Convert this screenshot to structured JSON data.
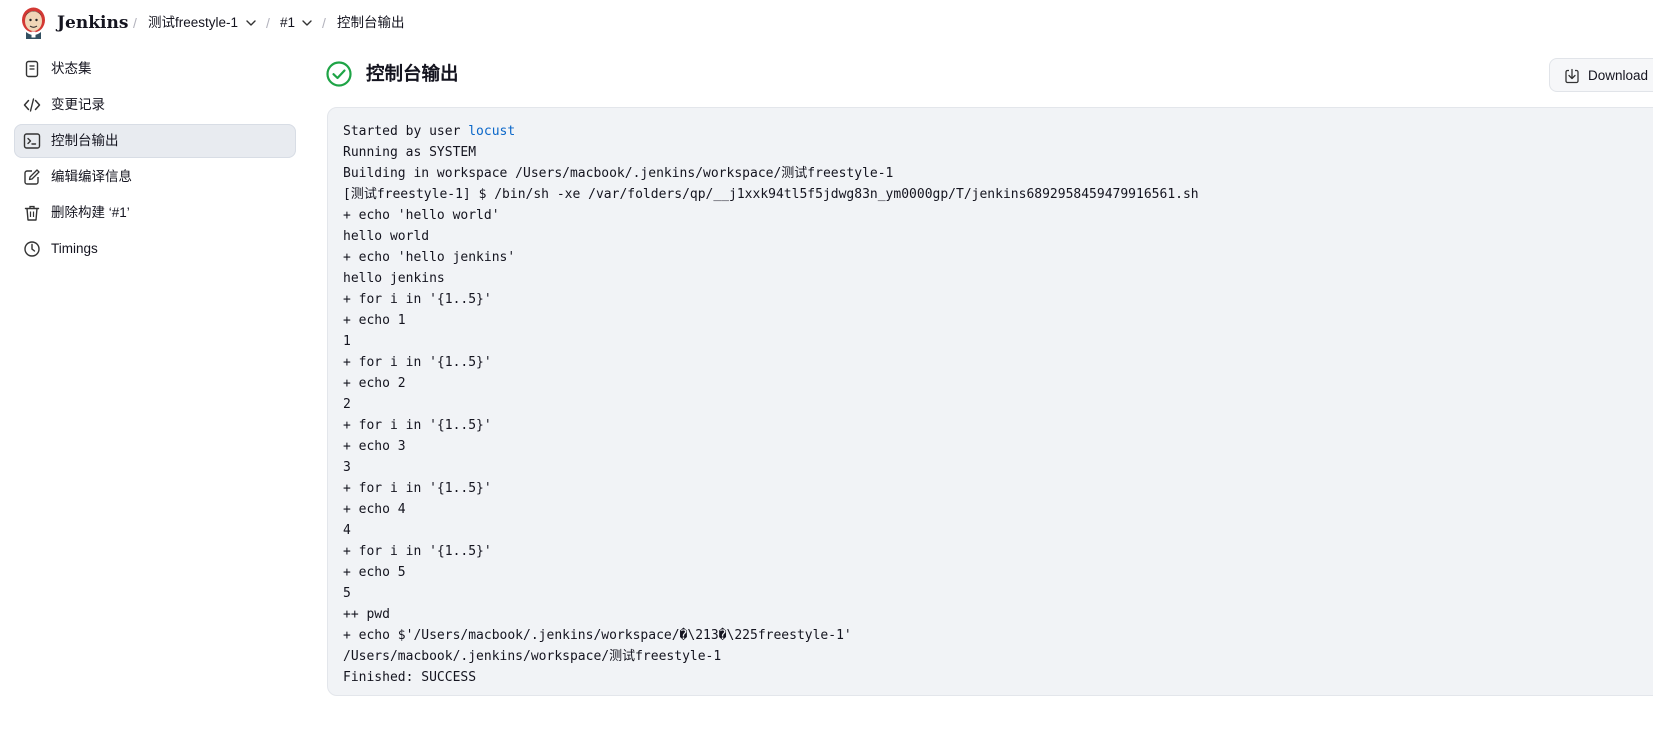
{
  "header": {
    "brand": "Jenkins",
    "breadcrumb": [
      {
        "label": "测试freestyle-1",
        "has_dropdown": true
      },
      {
        "label": "#1",
        "has_dropdown": true
      },
      {
        "label": "控制台输出",
        "has_dropdown": false
      }
    ]
  },
  "sidebar": {
    "items": [
      {
        "label": "状态集",
        "icon": "document-icon",
        "active": false
      },
      {
        "label": "变更记录",
        "icon": "code-icon",
        "active": false
      },
      {
        "label": "控制台输出",
        "icon": "terminal-icon",
        "active": true
      },
      {
        "label": "编辑编译信息",
        "icon": "edit-icon",
        "active": false
      },
      {
        "label": "删除构建 ‘#1’",
        "icon": "trash-icon",
        "active": false
      },
      {
        "label": "Timings",
        "icon": "clock-icon",
        "active": false
      }
    ]
  },
  "main": {
    "title": "控制台输出",
    "status": "success",
    "download_label": "Download"
  },
  "console": {
    "first_line_prefix": "Started by user ",
    "first_line_user": "locust",
    "lines": [
      "Running as SYSTEM",
      "Building in workspace /Users/macbook/.jenkins/workspace/测试freestyle-1",
      "[测试freestyle-1] $ /bin/sh -xe /var/folders/qp/__j1xxk94tl5f5jdwg83n_ym0000gp/T/jenkins6892958459479916561.sh",
      "+ echo 'hello world'",
      "hello world",
      "+ echo 'hello jenkins'",
      "hello jenkins",
      "+ for i in '{1..5}'",
      "+ echo 1",
      "1",
      "+ for i in '{1..5}'",
      "+ echo 2",
      "2",
      "+ for i in '{1..5}'",
      "+ echo 3",
      "3",
      "+ for i in '{1..5}'",
      "+ echo 4",
      "4",
      "+ for i in '{1..5}'",
      "+ echo 5",
      "5",
      "++ pwd",
      "+ echo $'/Users/macbook/.jenkins/workspace/�\\213�\\225freestyle-1'",
      "/Users/macbook/.jenkins/workspace/测试freestyle-1",
      "Finished: SUCCESS"
    ]
  },
  "colors": {
    "accent_link": "#0b67c9",
    "success": "#1ea446",
    "active_bg": "#e8ebf0",
    "console_bg": "#f1f3f6"
  }
}
